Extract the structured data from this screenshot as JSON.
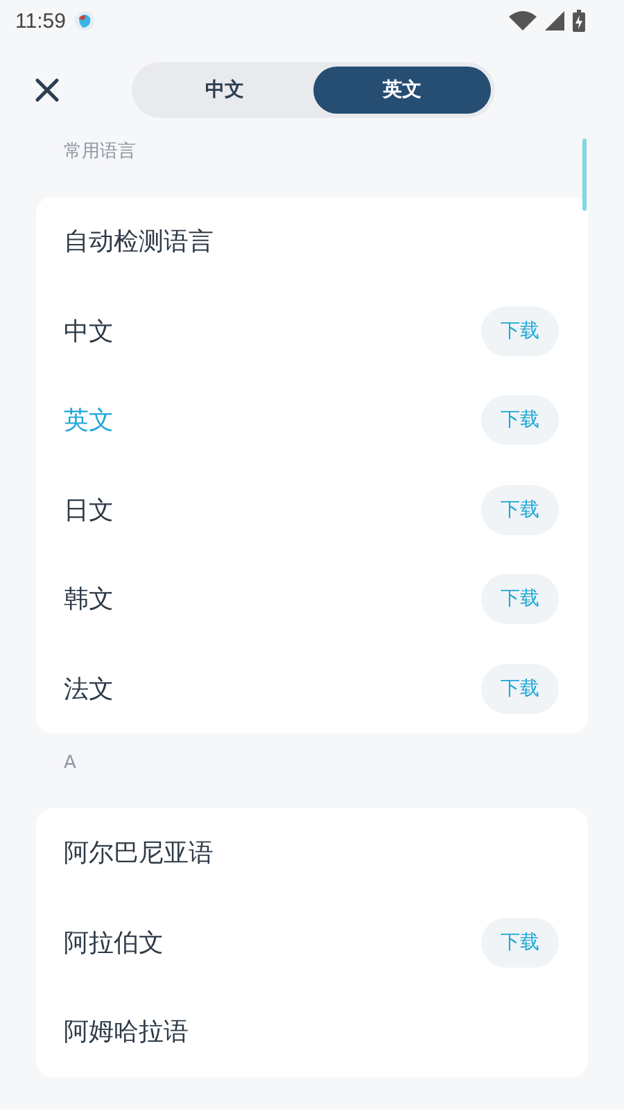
{
  "status_bar": {
    "time": "11:59"
  },
  "tabs": [
    {
      "label": "中文",
      "selected": false
    },
    {
      "label": "英文",
      "selected": true
    }
  ],
  "sections": [
    {
      "title": "常用语言",
      "items": [
        {
          "name": "自动检测语言",
          "selected": false
        },
        {
          "name": "中文",
          "selected": false,
          "action": "下载"
        },
        {
          "name": "英文",
          "selected": true,
          "action": "下载"
        },
        {
          "name": "日文",
          "selected": false,
          "action": "下载"
        },
        {
          "name": "韩文",
          "selected": false,
          "action": "下载"
        },
        {
          "name": "法文",
          "selected": false,
          "action": "下载"
        }
      ]
    },
    {
      "title": "A",
      "items": [
        {
          "name": "阿尔巴尼亚语",
          "selected": false
        },
        {
          "name": "阿拉伯文",
          "selected": false,
          "action": "下载"
        },
        {
          "name": "阿姆哈拉语",
          "selected": false
        }
      ]
    }
  ]
}
